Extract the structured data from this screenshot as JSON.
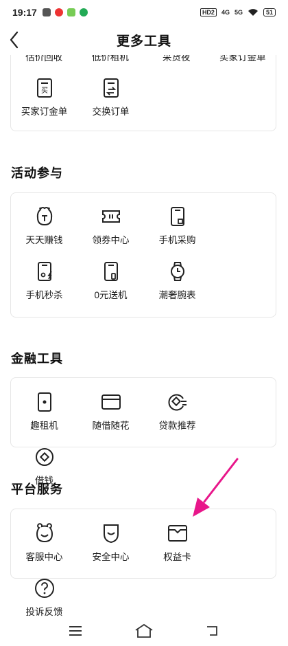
{
  "status_bar": {
    "time": "19:17",
    "hd": "HD2",
    "net1": "4G",
    "net2": "5G",
    "battery": "51"
  },
  "header": {
    "title": "更多工具"
  },
  "top_section": {
    "cut_items": [
      "估价回收",
      "低价租机",
      "采货夜",
      "买家订金单"
    ],
    "items": [
      {
        "label": "买家订金单",
        "icon": "deposit-order-icon"
      },
      {
        "label": "交换订单",
        "icon": "exchange-order-icon"
      }
    ]
  },
  "activity": {
    "title": "活动参与",
    "items": [
      {
        "label": "天天赚钱",
        "icon": "money-bag-icon"
      },
      {
        "label": "领券中心",
        "icon": "coupon-icon"
      },
      {
        "label": "手机采购",
        "icon": "phone-purchase-icon"
      },
      {
        "label": "手机秒杀",
        "icon": "phone-flash-sale-icon"
      },
      {
        "label": "0元送机",
        "icon": "free-phone-icon"
      },
      {
        "label": "潮奢腕表",
        "icon": "watch-icon"
      }
    ]
  },
  "finance": {
    "title": "金融工具",
    "items": [
      {
        "label": "趣租机",
        "icon": "rent-phone-icon"
      },
      {
        "label": "随借随花",
        "icon": "card-icon"
      },
      {
        "label": "贷款推荐",
        "icon": "loan-icon"
      },
      {
        "label": "借钱",
        "icon": "borrow-icon"
      }
    ]
  },
  "platform": {
    "title": "平台服务",
    "items": [
      {
        "label": "客服中心",
        "icon": "customer-service-icon"
      },
      {
        "label": "安全中心",
        "icon": "shield-icon"
      },
      {
        "label": "权益卡",
        "icon": "benefit-card-icon"
      },
      {
        "label": "投诉反馈",
        "icon": "question-icon"
      }
    ]
  },
  "colors": {
    "annotation_arrow": "#e8168a",
    "text": "#1a1a1a",
    "border": "#e6e6e6"
  }
}
